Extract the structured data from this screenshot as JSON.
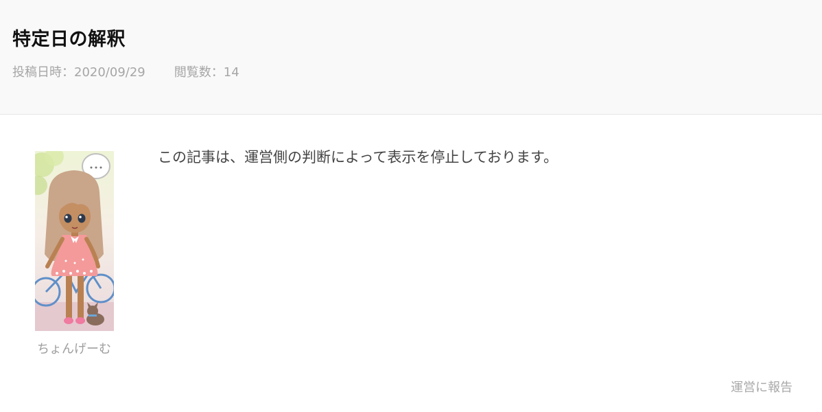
{
  "article": {
    "title": "特定日の解釈",
    "posted_label": "投稿日時：2020/09/29",
    "views_label": "閲覧数：14",
    "body": "この記事は、運営側の判断によって表示を停止しております。"
  },
  "author": {
    "name": "ちょんげーむ",
    "avatar_icon": "girl-avatar-illustration"
  },
  "actions": {
    "report_label": "運営に報告"
  },
  "colors": {
    "header_bg": "#f9f9f9",
    "meta_text": "#a6a6a6",
    "dress_pink": "#f49a9a",
    "hair": "#c9a58a"
  }
}
